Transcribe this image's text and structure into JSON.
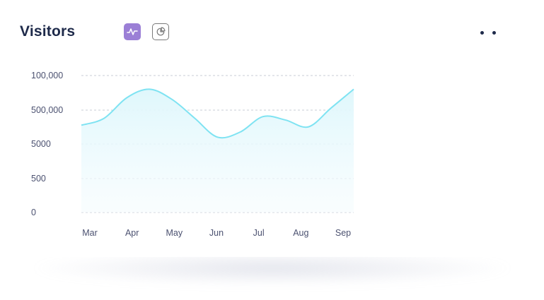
{
  "card": {
    "title": "Visitors"
  },
  "toolbar": {
    "line_toggle_icon": "line-chart-icon",
    "pie_toggle_icon": "pie-chart-icon",
    "more_icon": "more-dots-icon"
  },
  "colors": {
    "accent": "#9b7fd6",
    "line": "#7fe3f2",
    "fill": "#e4f8fc",
    "title": "#1e2a4a",
    "grid": "#c9ccd6"
  },
  "chart_data": {
    "type": "area",
    "title": "Visitors",
    "x": [
      "Mar",
      "Apr",
      "May",
      "Jun",
      "Jul",
      "Aug",
      "Sep"
    ],
    "y_tick_labels": [
      "0",
      "500",
      "5000",
      "500,000",
      "100,000"
    ],
    "series": [
      {
        "x": [
          "Mar",
          "Mar-Apr",
          "Apr",
          "Apr-May",
          "May",
          "May-Jun",
          "Jun",
          "Jun-Jul",
          "Jul",
          "Jul-Aug",
          "Aug",
          "Aug-Sep",
          "Sep"
        ],
        "values": [
          2.55,
          2.75,
          3.35,
          3.6,
          3.3,
          2.75,
          2.2,
          2.35,
          2.8,
          2.7,
          2.5,
          3.05,
          3.6
        ]
      }
    ],
    "y_units_note": "",
    "grid": true,
    "legend": "none",
    "line_color": "#7fe3f2",
    "fill_color": "#e4f8fc"
  }
}
